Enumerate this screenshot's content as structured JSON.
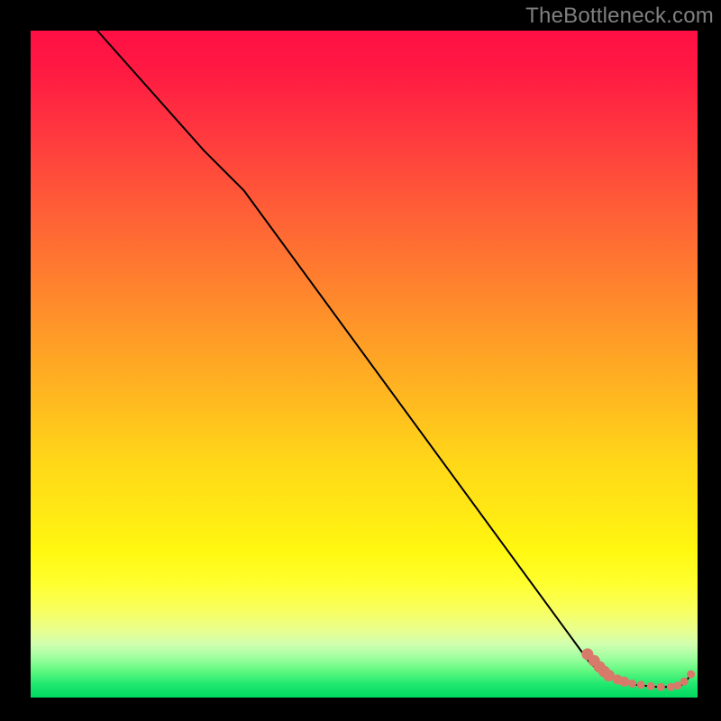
{
  "watermark": "TheBottleneck.com",
  "chart_data": {
    "type": "line",
    "title": "",
    "xlabel": "",
    "ylabel": "",
    "xlim": [
      0,
      100
    ],
    "ylim": [
      0,
      100
    ],
    "series": [
      {
        "name": "curve",
        "x": [
          10,
          26,
          32,
          84,
          86,
          88,
          90,
          92,
          94,
          96,
          98,
          99
        ],
        "y": [
          100,
          82,
          76,
          5,
          3.5,
          2.5,
          2,
          1.8,
          1.6,
          1.6,
          2,
          3.5
        ]
      }
    ],
    "markers": {
      "name": "highlight-segment",
      "color": "#d87a6a",
      "points": [
        {
          "x": 83.5,
          "y": 6.5
        },
        {
          "x": 84.5,
          "y": 5.5
        },
        {
          "x": 85.3,
          "y": 4.6
        },
        {
          "x": 86.0,
          "y": 3.9
        },
        {
          "x": 86.7,
          "y": 3.3
        },
        {
          "x": 88.0,
          "y": 2.7
        },
        {
          "x": 89.0,
          "y": 2.4
        },
        {
          "x": 90.2,
          "y": 2.1
        },
        {
          "x": 91.5,
          "y": 1.9
        },
        {
          "x": 93.0,
          "y": 1.7
        },
        {
          "x": 94.5,
          "y": 1.6
        },
        {
          "x": 96.0,
          "y": 1.6
        },
        {
          "x": 97.0,
          "y": 1.8
        },
        {
          "x": 98.0,
          "y": 2.4
        },
        {
          "x": 99.0,
          "y": 3.5
        }
      ]
    }
  }
}
